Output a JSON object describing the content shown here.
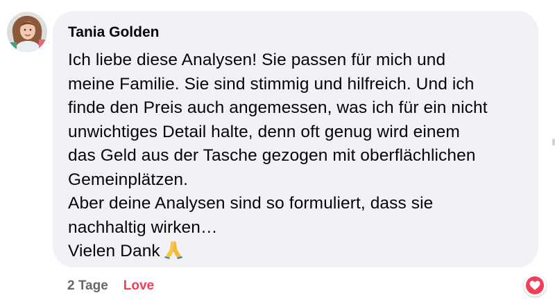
{
  "comment": {
    "author": "Tania Golden",
    "lines": [
      "Ich liebe diese Analysen! Sie passen für mich und",
      "meine Familie. Sie sind stimmig und hilfreich. Und ich",
      "finde den Preis auch angemessen, was ich für ein nicht",
      "unwichtiges Detail halte, denn oft genug wird einem",
      "das Geld aus der Tasche gezogen mit oberflächlichen",
      "Gemeinplätzen.",
      "Aber deine Analysen sind so formuliert, dass sie",
      "nachhaltig wirken…",
      "Vielen Dank"
    ],
    "emoji": "folded-hands-emoji"
  },
  "actions": {
    "time": "2 Tage",
    "reaction": "Love"
  },
  "reaction_badge": {
    "icon": "heart-icon",
    "color": "#f33e58"
  },
  "colors": {
    "bubble": "#f0f2f5",
    "text": "#050505",
    "muted": "#65676b",
    "love": "#f33e58"
  }
}
